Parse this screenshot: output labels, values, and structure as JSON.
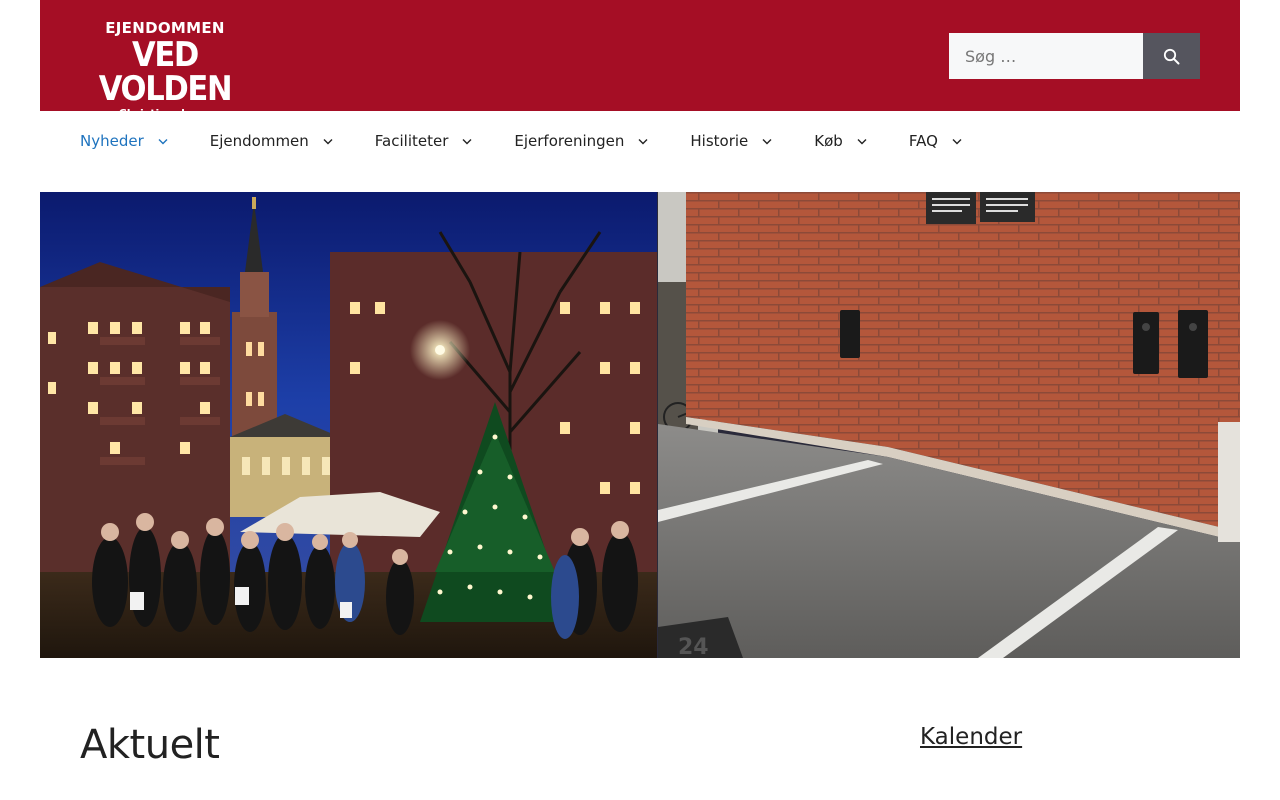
{
  "header": {
    "logo": {
      "top": "EJENDOMMEN",
      "main": "VED VOLDEN",
      "sub": "Christianshavn"
    },
    "search": {
      "placeholder": "Søg …",
      "button_icon": "search-icon"
    }
  },
  "nav": {
    "items": [
      {
        "label": "Nyheder",
        "active": true
      },
      {
        "label": "Ejendommen",
        "active": false
      },
      {
        "label": "Faciliteter",
        "active": false
      },
      {
        "label": "Ejerforeningen",
        "active": false
      },
      {
        "label": "Historie",
        "active": false
      },
      {
        "label": "Køb",
        "active": false
      },
      {
        "label": "FAQ",
        "active": false
      }
    ],
    "dropdown_icon": "chevron-down-icon"
  },
  "hero": {
    "left_image": "christmas-tree-gathering-photo",
    "right_image": "brick-wall-ev-chargers-photo"
  },
  "main": {
    "title": "Aktuelt"
  },
  "sidebar": {
    "title": "Kalender"
  },
  "colors": {
    "brand": "#a50e25",
    "active_link": "#1e73be",
    "search_button": "#55555e"
  }
}
